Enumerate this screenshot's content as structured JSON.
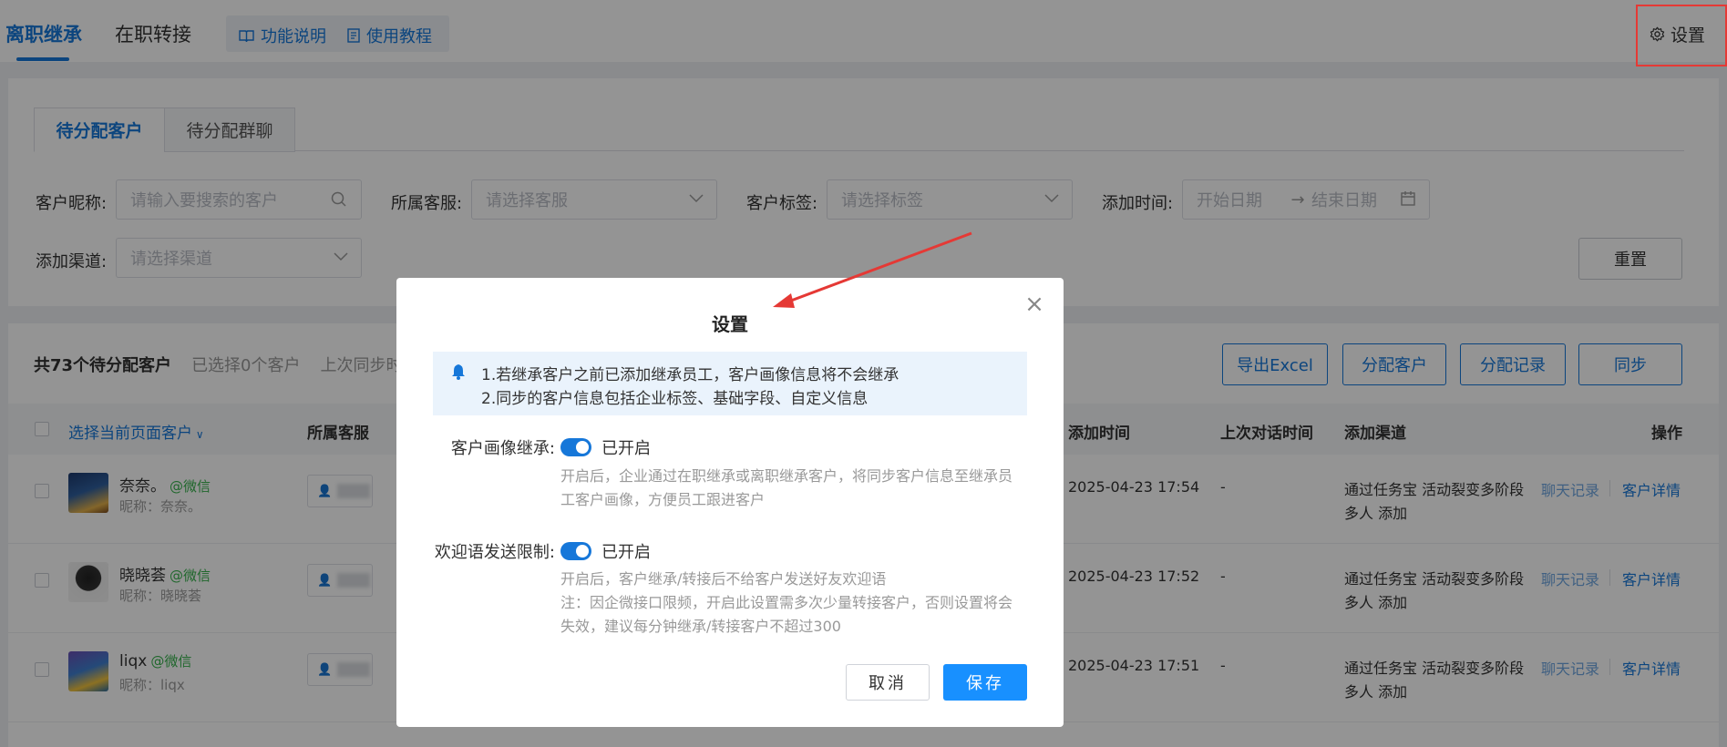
{
  "topnav": {
    "tabs": [
      "离职继承",
      "在职转接"
    ],
    "help_links": [
      "功能说明",
      "使用教程"
    ],
    "settings_label": "设置"
  },
  "subtabs": [
    "待分配客户",
    "待分配群聊"
  ],
  "filters": {
    "nickname_label": "客户昵称:",
    "nickname_placeholder": "请输入要搜索的客户",
    "staff_label": "所属客服:",
    "staff_placeholder": "请选择客服",
    "tag_label": "客户标签:",
    "tag_placeholder": "请选择标签",
    "time_label": "添加时间:",
    "start_placeholder": "开始日期",
    "end_placeholder": "结束日期",
    "channel_label": "添加渠道:",
    "channel_placeholder": "请选择渠道",
    "reset_label": "重置"
  },
  "summary": {
    "total": "共73个待分配客户",
    "selected": "已选择0个客户",
    "last_sync": "上次同步时"
  },
  "actions": [
    "导出Excel",
    "分配客户",
    "分配记录",
    "同步"
  ],
  "table": {
    "headers": {
      "select_page": "选择当前页面客户",
      "staff": "所属客服",
      "add_time": "添加时间",
      "last_chat": "上次对话时间",
      "channel": "添加渠道",
      "operation": "操作"
    },
    "rows": [
      {
        "name": "奈奈。",
        "source": "@微信",
        "nick": "昵称：奈奈。",
        "add_time": "2025-04-23 17:54",
        "last_chat": "-",
        "channel": "通过任务宝 活动裂变多阶段多人 添加",
        "chat_link": "聊天记录",
        "detail_link": "客户详情"
      },
      {
        "name": "晓晓荟",
        "source": "@微信",
        "nick": "昵称：晓晓荟",
        "add_time": "2025-04-23 17:52",
        "last_chat": "-",
        "channel": "通过任务宝 活动裂变多阶段多人 添加",
        "chat_link": "聊天记录",
        "detail_link": "客户详情"
      },
      {
        "name": "liqx",
        "source": "@微信",
        "nick": "昵称：liqx",
        "add_time": "2025-04-23 17:51",
        "last_chat": "-",
        "channel": "通过任务宝 活动裂变多阶段多人 添加",
        "chat_link": "聊天记录",
        "detail_link": "客户详情"
      }
    ]
  },
  "modal": {
    "title": "设置",
    "notice": [
      "1.若继承客户之前已添加继承员工，客户画像信息将不会继承",
      "2.同步的客户信息包括企业标签、基础字段、自定义信息"
    ],
    "settings": [
      {
        "label": "客户画像继承:",
        "state": "已开启",
        "enabled": true,
        "desc": [
          "开启后，企业通过在职继承或离职继承客户，将同步客户信息至继承员工客户画像，方便员工跟进客户"
        ]
      },
      {
        "label": "欢迎语发送限制:",
        "state": "已开启",
        "enabled": true,
        "desc": [
          "开启后，客户继承/转接后不给客户发送好友欢迎语",
          "注：因企微接口限频，开启此设置需多次少量转接客户，否则设置将会失效，建议每分钟继承/转接客户不超过300"
        ]
      }
    ],
    "cancel_label": "取消",
    "save_label": "保存"
  },
  "colors": {
    "accent": "#1677d9",
    "save": "#1890ff",
    "highlight": "#e53935",
    "wechat": "#37b24d"
  }
}
